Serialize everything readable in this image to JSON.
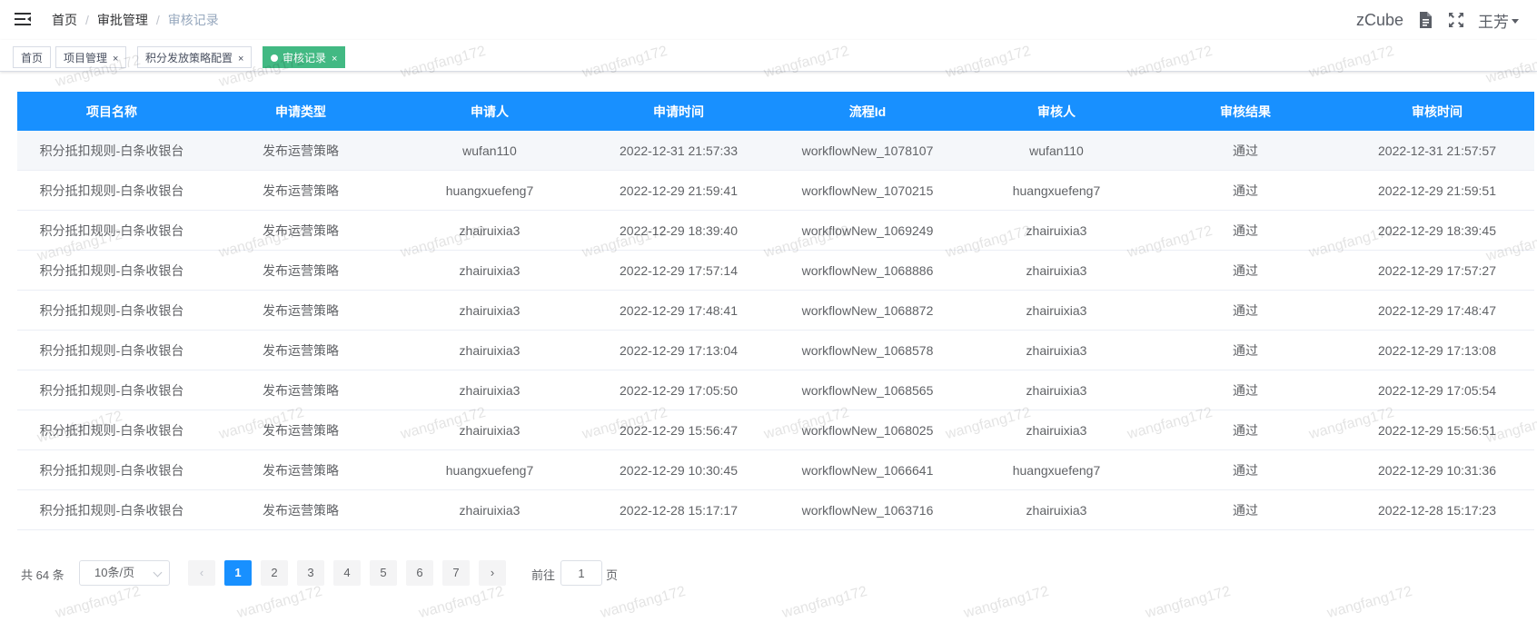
{
  "header": {
    "breadcrumbs": [
      "首页",
      "审批管理",
      "审核记录"
    ],
    "brand": "zCube",
    "user": "王芳",
    "icons": [
      "hamburger-icon",
      "document-icon",
      "fullscreen-icon",
      "caret-down-icon"
    ]
  },
  "tags": [
    {
      "label": "首页",
      "closable": false,
      "active": false
    },
    {
      "label": "项目管理",
      "closable": true,
      "active": false
    },
    {
      "label": "积分发放策略配置",
      "closable": true,
      "active": false
    },
    {
      "label": "审核记录",
      "closable": true,
      "active": true
    }
  ],
  "close_glyph": "×",
  "table": {
    "columns": [
      "项目名称",
      "申请类型",
      "申请人",
      "申请时间",
      "流程Id",
      "审核人",
      "审核结果",
      "审核时间"
    ],
    "rows": [
      [
        "积分抵扣规则-白条收银台",
        "发布运营策略",
        "wufan110",
        "2022-12-31 21:57:33",
        "workflowNew_1078107",
        "wufan110",
        "通过",
        "2022-12-31 21:57:57"
      ],
      [
        "积分抵扣规则-白条收银台",
        "发布运营策略",
        "huangxuefeng7",
        "2022-12-29 21:59:41",
        "workflowNew_1070215",
        "huangxuefeng7",
        "通过",
        "2022-12-29 21:59:51"
      ],
      [
        "积分抵扣规则-白条收银台",
        "发布运营策略",
        "zhairuixia3",
        "2022-12-29 18:39:40",
        "workflowNew_1069249",
        "zhairuixia3",
        "通过",
        "2022-12-29 18:39:45"
      ],
      [
        "积分抵扣规则-白条收银台",
        "发布运营策略",
        "zhairuixia3",
        "2022-12-29 17:57:14",
        "workflowNew_1068886",
        "zhairuixia3",
        "通过",
        "2022-12-29 17:57:27"
      ],
      [
        "积分抵扣规则-白条收银台",
        "发布运营策略",
        "zhairuixia3",
        "2022-12-29 17:48:41",
        "workflowNew_1068872",
        "zhairuixia3",
        "通过",
        "2022-12-29 17:48:47"
      ],
      [
        "积分抵扣规则-白条收银台",
        "发布运营策略",
        "zhairuixia3",
        "2022-12-29 17:13:04",
        "workflowNew_1068578",
        "zhairuixia3",
        "通过",
        "2022-12-29 17:13:08"
      ],
      [
        "积分抵扣规则-白条收银台",
        "发布运营策略",
        "zhairuixia3",
        "2022-12-29 17:05:50",
        "workflowNew_1068565",
        "zhairuixia3",
        "通过",
        "2022-12-29 17:05:54"
      ],
      [
        "积分抵扣规则-白条收银台",
        "发布运营策略",
        "zhairuixia3",
        "2022-12-29 15:56:47",
        "workflowNew_1068025",
        "zhairuixia3",
        "通过",
        "2022-12-29 15:56:51"
      ],
      [
        "积分抵扣规则-白条收银台",
        "发布运营策略",
        "huangxuefeng7",
        "2022-12-29 10:30:45",
        "workflowNew_1066641",
        "huangxuefeng7",
        "通过",
        "2022-12-29 10:31:36"
      ],
      [
        "积分抵扣规则-白条收银台",
        "发布运营策略",
        "zhairuixia3",
        "2022-12-28 15:17:17",
        "workflowNew_1063716",
        "zhairuixia3",
        "通过",
        "2022-12-28 15:17:23"
      ]
    ]
  },
  "pagination": {
    "total_text": "共 64 条",
    "page_size_label": "10条/页",
    "pages": [
      "1",
      "2",
      "3",
      "4",
      "5",
      "6",
      "7"
    ],
    "current_page": 1,
    "prev_glyph": "‹",
    "next_glyph": "›",
    "jump_prefix": "前往",
    "jump_value": "1",
    "jump_suffix": "页"
  },
  "watermark": "wangfang172",
  "colors": {
    "header_bg": "#1890ff",
    "active_tag": "#42b983",
    "active_page": "#1890ff"
  }
}
